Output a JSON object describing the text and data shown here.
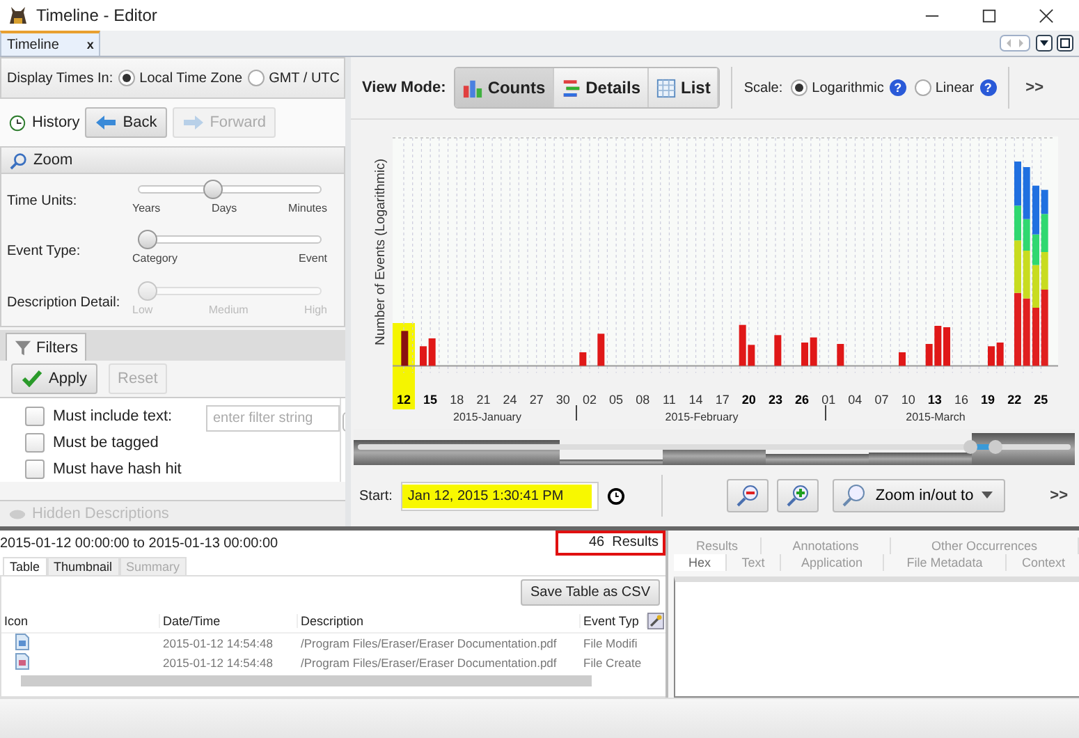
{
  "window": {
    "title": "Timeline - Editor"
  },
  "document_tabs": [
    {
      "label": "Timeline",
      "close": "x",
      "selected": true
    }
  ],
  "display_times": {
    "label": "Display Times In:",
    "options": [
      {
        "label": "Local Time Zone",
        "selected": true
      },
      {
        "label": "GMT / UTC",
        "selected": false
      }
    ]
  },
  "history": {
    "label": "History",
    "buttons": [
      {
        "label": "Back",
        "disabled": false
      },
      {
        "label": "Forward",
        "disabled": true
      }
    ]
  },
  "zoom_panel": {
    "title": "Zoom",
    "sliders": [
      {
        "label": "Time Units:",
        "level": 0.4,
        "disabled": false,
        "ticks": [
          "Years",
          "Days",
          "Minutes"
        ]
      },
      {
        "label": "Event Type:",
        "level": 0,
        "disabled": false,
        "ticks": [
          "Category",
          "Event"
        ]
      },
      {
        "label": "Description Detail:",
        "level": 0,
        "disabled": true,
        "ticks": [
          "Low",
          "Medium",
          "High"
        ]
      }
    ]
  },
  "filters": {
    "tab": "Filters",
    "buttons": [
      {
        "label": "Apply",
        "disabled": false
      },
      {
        "label": "Reset",
        "disabled": true
      }
    ],
    "items": [
      {
        "label": "Must include text:",
        "checked": false,
        "placeholder": "enter filter string"
      },
      {
        "label": "Must be tagged",
        "checked": false
      },
      {
        "label": "Must have hash hit",
        "checked": false
      }
    ]
  },
  "hidden_descriptions": {
    "label": "Hidden Descriptions",
    "disabled": true
  },
  "view_mode": {
    "label": "View Mode:",
    "buttons": [
      {
        "label": "Counts",
        "selected": true
      },
      {
        "label": "Details",
        "selected": false
      },
      {
        "label": "List",
        "selected": false
      }
    ]
  },
  "scale": {
    "label": "Scale:",
    "options": [
      {
        "label": "Logarithmic",
        "selected": true,
        "help": "?"
      },
      {
        "label": "Linear",
        "selected": false,
        "help": "?"
      }
    ],
    "more": ">>"
  },
  "histogram": {
    "ylabel": "Number of Events (Logarithmic)",
    "dates": [
      {
        "label": "12",
        "bold": true,
        "highlighted": true
      },
      {
        "label": "15",
        "bold": true,
        "highlighted": false
      },
      {
        "label": "18",
        "bold": false,
        "highlighted": false
      },
      {
        "label": "21",
        "bold": false,
        "highlighted": false
      },
      {
        "label": "24",
        "bold": false,
        "highlighted": false
      },
      {
        "label": "27",
        "bold": false,
        "highlighted": false
      },
      {
        "label": "30",
        "bold": false,
        "highlighted": false
      },
      {
        "label": "02",
        "bold": false,
        "highlighted": false
      },
      {
        "label": "05",
        "bold": false,
        "highlighted": false
      },
      {
        "label": "08",
        "bold": false,
        "highlighted": false
      },
      {
        "label": "11",
        "bold": false,
        "highlighted": false
      },
      {
        "label": "14",
        "bold": false,
        "highlighted": false
      },
      {
        "label": "17",
        "bold": false,
        "highlighted": false
      },
      {
        "label": "20",
        "bold": true,
        "highlighted": false
      },
      {
        "label": "23",
        "bold": true,
        "highlighted": false
      },
      {
        "label": "26",
        "bold": true,
        "highlighted": false
      },
      {
        "label": "01",
        "bold": false,
        "highlighted": false
      },
      {
        "label": "04",
        "bold": false,
        "highlighted": false
      },
      {
        "label": "07",
        "bold": false,
        "highlighted": false
      },
      {
        "label": "10",
        "bold": false,
        "highlighted": false
      },
      {
        "label": "13",
        "bold": true,
        "highlighted": false
      },
      {
        "label": "16",
        "bold": false,
        "highlighted": false
      },
      {
        "label": "19",
        "bold": true,
        "highlighted": false
      },
      {
        "label": "22",
        "bold": true,
        "highlighted": false
      },
      {
        "label": "25",
        "bold": true,
        "highlighted": false
      }
    ],
    "months": [
      "2015-January",
      "2015-February",
      "2015-March"
    ]
  },
  "range_slider": {
    "thumbs": [
      {
        "level": 0.855
      },
      {
        "level": 0.89
      }
    ]
  },
  "time_range": {
    "label": "Start:",
    "value": "Jan 12, 2015 1:30:41 PM",
    "highlighted": true,
    "zoom_menu": "Zoom in/out to",
    "more": ">>"
  },
  "results": {
    "range": "2015-01-12 00:00:00 to 2015-01-13 00:00:00",
    "count": "46  Results",
    "tabs": [
      {
        "label": "Table",
        "selected": true,
        "disabled": false
      },
      {
        "label": "Thumbnail",
        "selected": false,
        "disabled": false
      },
      {
        "label": "Summary",
        "selected": false,
        "disabled": true
      }
    ],
    "save_button": "Save Table as CSV",
    "columns": [
      "Icon",
      "Date/Time",
      "Description",
      "Event Typ"
    ],
    "rows": [
      {
        "date": "2015-01-12 14:54:48",
        "description": "/Program Files/Eraser/Eraser Documentation.pdf",
        "event_type": "File Modifi"
      },
      {
        "date": "2015-01-12 14:54:48",
        "description": "/Program Files/Eraser/Eraser Documentation.pdf",
        "event_type": "File Create"
      }
    ]
  },
  "viewer": {
    "tabs_top": [
      {
        "label": "Results",
        "selected": false
      },
      {
        "label": "Annotations",
        "selected": false
      },
      {
        "label": "Other Occurrences",
        "selected": false
      }
    ],
    "tabs": [
      {
        "label": "Hex",
        "selected": true
      },
      {
        "label": "Text",
        "selected": false
      },
      {
        "label": "Application",
        "selected": false
      },
      {
        "label": "File Metadata",
        "selected": false
      },
      {
        "label": "Context",
        "selected": false
      }
    ]
  }
}
